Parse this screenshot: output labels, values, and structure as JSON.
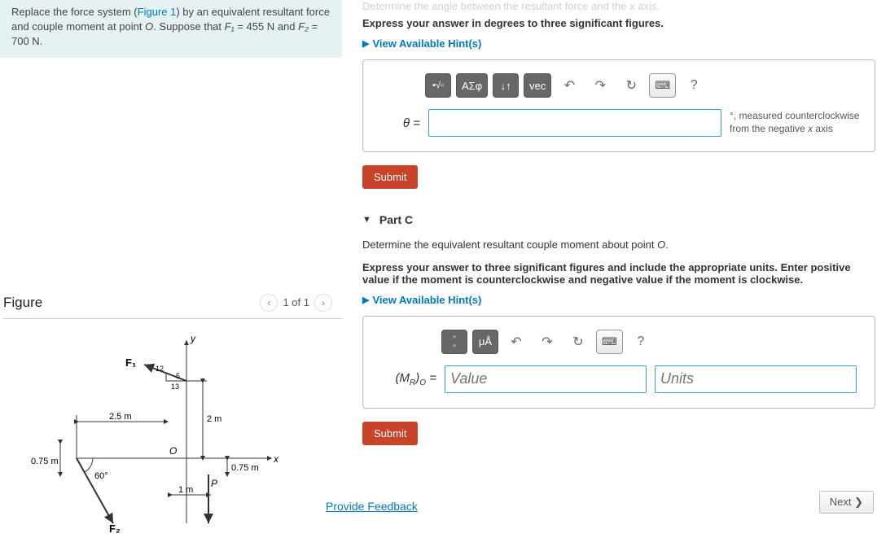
{
  "problem": {
    "text_a": "Replace the force system (",
    "figure_link": "Figure 1",
    "text_b": ") by an equivalent resultant force and couple moment at point ",
    "pointO": "O",
    "text_c": ". Suppose that ",
    "f1_label": "F₁",
    "f1_eq": " = 455 N",
    "and": " and ",
    "f2_label": "F₂",
    "f2_eq": " = 700 N",
    "period": "."
  },
  "figure": {
    "title": "Figure",
    "pager": "1 of 1",
    "labels": {
      "y": "y",
      "x": "x",
      "O": "O",
      "F1": "F₁",
      "F2": "F₂",
      "P": "P",
      "d25": "2.5 m",
      "d075a": "0.75 m",
      "d075b": "0.75 m",
      "d2m": "2 m",
      "d1m": "1 m",
      "ang60": "60°",
      "t12": "12",
      "t13": "13",
      "t5": "5"
    }
  },
  "partB": {
    "partial_top": "Determine the angle between the resultant force and the x axis.",
    "instruction": "Express your answer in degrees to three significant figures.",
    "hints": "View Available Hint(s)",
    "toolbar": {
      "greek": "ΑΣφ",
      "arrows": "↓↑",
      "vec": "vec",
      "undo": "↶",
      "redo": "↷",
      "reset": "↻",
      "kbd": "⌨",
      "help": "?"
    },
    "theta_label": "θ =",
    "note": ", measured counterclockwise from the negative ",
    "note_axis": "x",
    "note_end": " axis",
    "deg": "°",
    "submit": "Submit"
  },
  "partC": {
    "header": "Part C",
    "desc": "Determine the equivalent resultant couple moment about point ",
    "pointO": "O",
    "period": ".",
    "instruction": "Express your answer to three significant figures and include the appropriate units. Enter positive value if the moment is counterclockwise and negative value if the moment is clockwise.",
    "hints": "View Available Hint(s)",
    "toolbar": {
      "units": "μÅ",
      "undo": "↶",
      "redo": "↷",
      "reset": "↻",
      "kbd": "⌨",
      "help": "?"
    },
    "mr_label_a": "(M",
    "mr_label_r": "R",
    "mr_label_b": ")",
    "mr_label_o": "O",
    "mr_label_eq": " =",
    "value_ph": "Value",
    "units_ph": "Units",
    "submit": "Submit"
  },
  "footer": {
    "feedback": "Provide Feedback",
    "next": "Next ❯"
  }
}
